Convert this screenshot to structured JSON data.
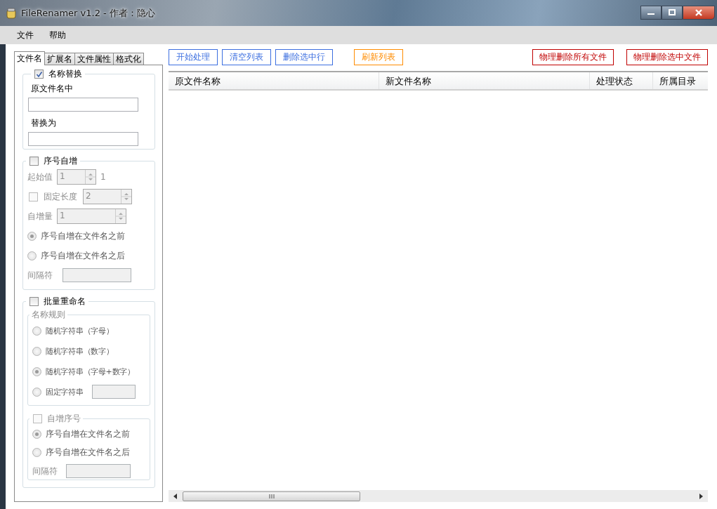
{
  "window": {
    "title": "FileRenamer v1.2 - 作者：隐心"
  },
  "menu": [
    "文件",
    "帮助"
  ],
  "tabs": [
    {
      "label": "文件名",
      "selected": true
    },
    {
      "label": "扩展名",
      "selected": false
    },
    {
      "label": "文件属性",
      "selected": false
    },
    {
      "label": "格式化",
      "selected": false
    }
  ],
  "name_replace": {
    "label": "名称替换",
    "checked": true,
    "fields": [
      {
        "label": "原文件名中"
      },
      {
        "label": "替换为"
      }
    ]
  },
  "serial": {
    "label": "序号自增",
    "checked": false,
    "start": {
      "label": "起始值",
      "value": "1",
      "reading": "1"
    },
    "fixed_length": {
      "label": "固定长度",
      "checked": false,
      "value": "2"
    },
    "step": {
      "label": "自增量",
      "value": "1"
    },
    "positions": [
      {
        "label": "序号自增在文件名之前",
        "selected": true
      },
      {
        "label": "序号自增在文件名之后",
        "selected": false
      }
    ],
    "separator": {
      "label": "间隔符"
    }
  },
  "batch": {
    "label": "批量重命名",
    "checked": false,
    "rules": {
      "label": "名称规则",
      "options": [
        {
          "label": "随机字符串（字母）",
          "selected": false
        },
        {
          "label": "随机字符串（数字）",
          "selected": false
        },
        {
          "label": "随机字符串（字母+数字）",
          "selected": true
        },
        {
          "label": "固定字符串",
          "selected": false,
          "kind": "field"
        }
      ]
    },
    "serial": {
      "label": "自增序号",
      "checked": false,
      "positions": [
        {
          "label": "序号自增在文件名之前",
          "selected": true
        },
        {
          "label": "序号自增在文件名之后",
          "selected": false
        }
      ],
      "separator": {
        "label": "间隔符"
      }
    }
  },
  "toolbar": [
    {
      "label": "开始处理",
      "color": "#3c6fe0"
    },
    {
      "label": "清空列表",
      "color": "#3c6fe0"
    },
    {
      "label": "删除选中行",
      "color": "#3c6fe0"
    },
    {
      "label": "刷新列表",
      "color": "#ff8c00"
    }
  ],
  "danger_buttons": [
    {
      "label": "物理删除所有文件",
      "color": "#c00000"
    },
    {
      "label": "物理删除选中文件",
      "color": "#c00000"
    }
  ],
  "table": {
    "columns": [
      "原文件名称",
      "新文件名称",
      "处理状态",
      "所属目录"
    ]
  }
}
